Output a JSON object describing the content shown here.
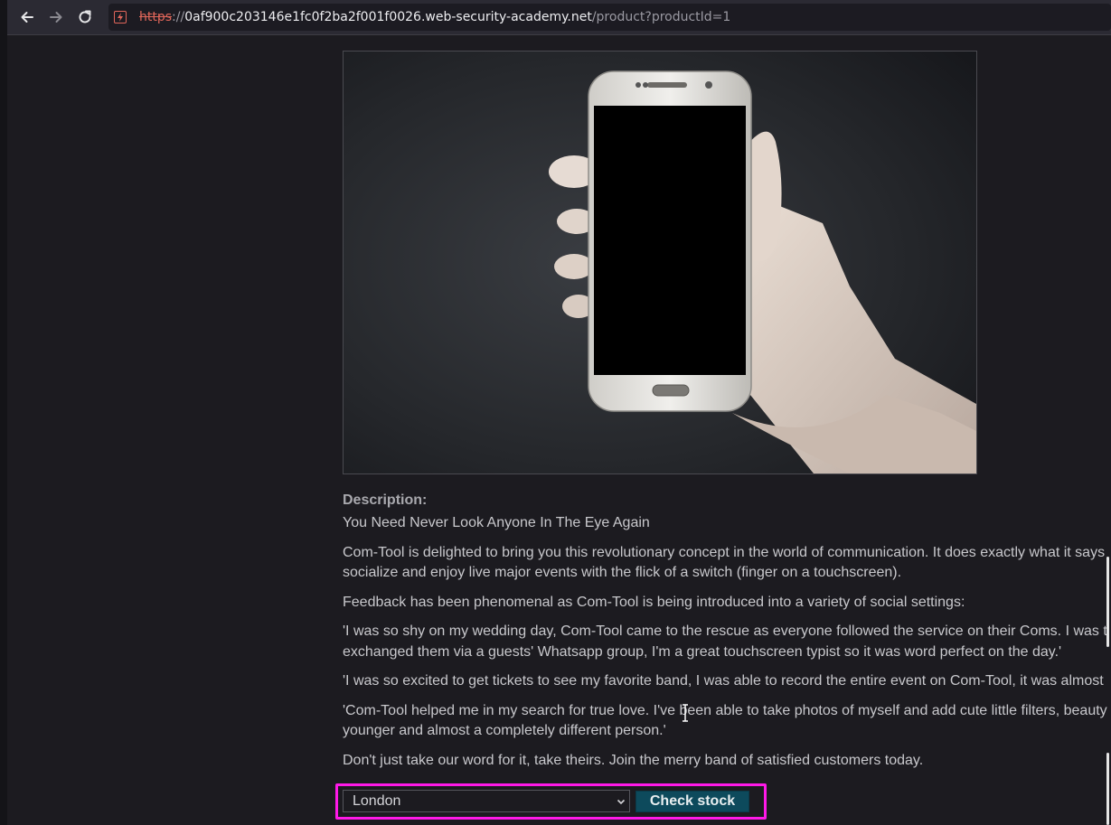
{
  "browser": {
    "url_scheme": "https",
    "url_separator": "://",
    "url_host": "0af900c203146e1fc0f2ba2f001f0026.web-security-academy.net",
    "url_path": "/product?productId=1",
    "back_icon": "arrow-left-icon",
    "forward_icon": "arrow-right-icon",
    "reload_icon": "reload-icon",
    "security_icon": "insecure-connection-icon"
  },
  "product": {
    "image_alt": "Hand holding a white smartphone with a black screen",
    "description_heading": "Description:",
    "tagline": "You Need Never Look Anyone In The Eye Again",
    "paragraphs": [
      "Com-Tool is delighted to bring you this revolutionary concept in the world of communication. It does exactly what it says",
      "socialize and enjoy live major events with the flick of a switch (finger on a touchscreen).",
      "Feedback has been phenomenal as Com-Tool is being introduced into a variety of social settings:",
      "'I was so shy on my wedding day, Com-Tool came to the rescue as everyone followed the service on their Coms. I was t",
      "exchanged them via a guests' Whatsapp group, I'm a great touchscreen typist so it was word perfect on the day.'",
      "'I was so excited to get tickets to see my favorite band, I was able to record the entire event on Com-Tool, it was almost",
      "'Com-Tool helped me in my search for true love. I've been able to take photos of myself and add cute little filters, beauty",
      "younger and almost a completely different person.'",
      "Don't just take our word for it, take theirs. Join the merry band of satisfied customers today."
    ]
  },
  "stock": {
    "selected_store": "London",
    "check_label": "Check stock"
  },
  "colors": {
    "highlight": "#ff19e8",
    "button_bg": "#0d4a5c",
    "page_bg": "#1c1b20"
  }
}
